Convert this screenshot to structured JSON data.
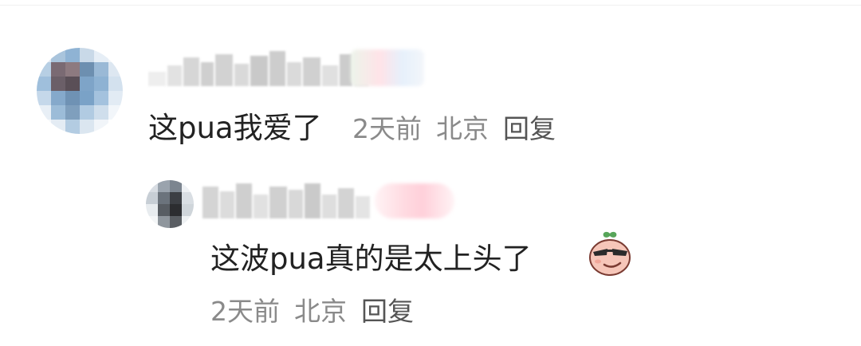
{
  "comment": {
    "text": "这pua我爱了",
    "time": "2天前",
    "location": "北京",
    "reply_label": "回复",
    "avatar_palette": [
      "#dfe8f2",
      "#a9c4dc",
      "#8fb3d4",
      "#c9d9e8",
      "#e6eef6",
      "#f0f4f8",
      "#b7cfe4",
      "#7a6a73",
      "#8d7a80",
      "#6d8fb0",
      "#9ab9d6",
      "#dde7f1",
      "#9fbfdc",
      "#6b5f68",
      "#5a4f57",
      "#7ea4c8",
      "#8eb2d3",
      "#d3e1ee",
      "#c5d8ea",
      "#85a9cb",
      "#6f92b4",
      "#7aa2c7",
      "#a4c2de",
      "#e2ebf4",
      "#e8eff6",
      "#9cbcd8",
      "#7f9fbd",
      "#b1cbe2",
      "#cfdeec",
      "#f2f6fa",
      "#f6f8fb",
      "#e4ecf4",
      "#b3cce2",
      "#dbe6f0",
      "#f1f5f9",
      "#ffffff"
    ]
  },
  "reply": {
    "text": "这波pua真的是太上头了",
    "emoji_name": "smirk-sunglasses-emoji",
    "time": "2天前",
    "location": "北京",
    "reply_label": "回复",
    "avatar_palette": [
      "#d8dde3",
      "#9aa3ad",
      "#7c858f",
      "#eef1f4",
      "#c7ced5",
      "#6b737c",
      "#3c3f44",
      "#d9dee3",
      "#e8ecef",
      "#585d63",
      "#2c2d30",
      "#cfd5da",
      "#f4f6f7",
      "#8f969d",
      "#5a5e63",
      "#eef1f3"
    ]
  },
  "colors": {
    "text": "#222222",
    "meta": "#8a8a8a",
    "reply_link": "#555555"
  }
}
